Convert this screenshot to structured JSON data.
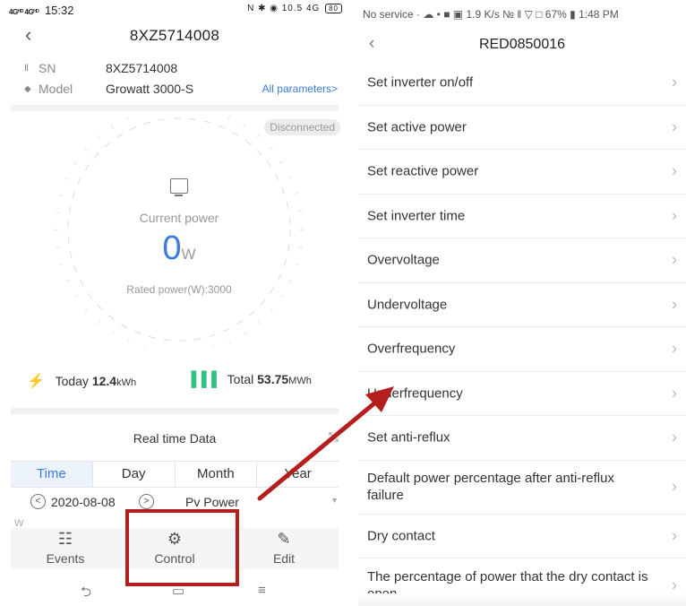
{
  "left": {
    "status_bar": {
      "signal": "4Gᴴᴰ 4Gᴴᴰ",
      "time": "15:32",
      "right": "N ✱ ◉ 10.5 4G",
      "battery": "80"
    },
    "title": "8XZ5714008",
    "info": {
      "sn_label": "SN",
      "sn_value": "8XZ5714008",
      "model_label": "Model",
      "model_value": "Growatt 3000-S",
      "all_params_link": "All parameters>"
    },
    "connection_badge": "Disconnected",
    "gauge": {
      "current_label": "Current power",
      "value": "0",
      "unit": "W",
      "rated": "Rated power(W):3000"
    },
    "today": {
      "label": "Today",
      "value": "12.4",
      "unit": "kWh"
    },
    "total": {
      "label": "Total",
      "value": "53.75",
      "unit": "MWh"
    },
    "realtime_title": "Real time Data",
    "tabs": [
      "Time",
      "Day",
      "Month",
      "Year"
    ],
    "date": "2020-08-08",
    "series_select": "Pv Power",
    "y_unit": "W",
    "bottom_bar": {
      "events": "Events",
      "control": "Control",
      "edit": "Edit"
    }
  },
  "right": {
    "status_bar": "No service · ☁ • ■ ▣   1.9 K/s № ‖ ▽ □ 67% ▮ 1:48 PM",
    "title": "RED0850016",
    "menu": [
      "Set inverter on/off",
      "Set active power",
      "Set reactive power",
      "Set inverter time",
      "Overvoltage",
      "Undervoltage",
      "Overfrequency",
      "Underfrequency",
      "Set anti-reflux",
      "Default power percentage after anti-reflux failure",
      "Dry contact",
      "The percentage of power that the dry contact is open"
    ]
  },
  "annotation": {
    "highlight_color": "#b41e1e"
  },
  "colors": {
    "accent": "#3a7be0",
    "green": "#2ec27e",
    "active_tab_bg": "#edf3fc"
  }
}
